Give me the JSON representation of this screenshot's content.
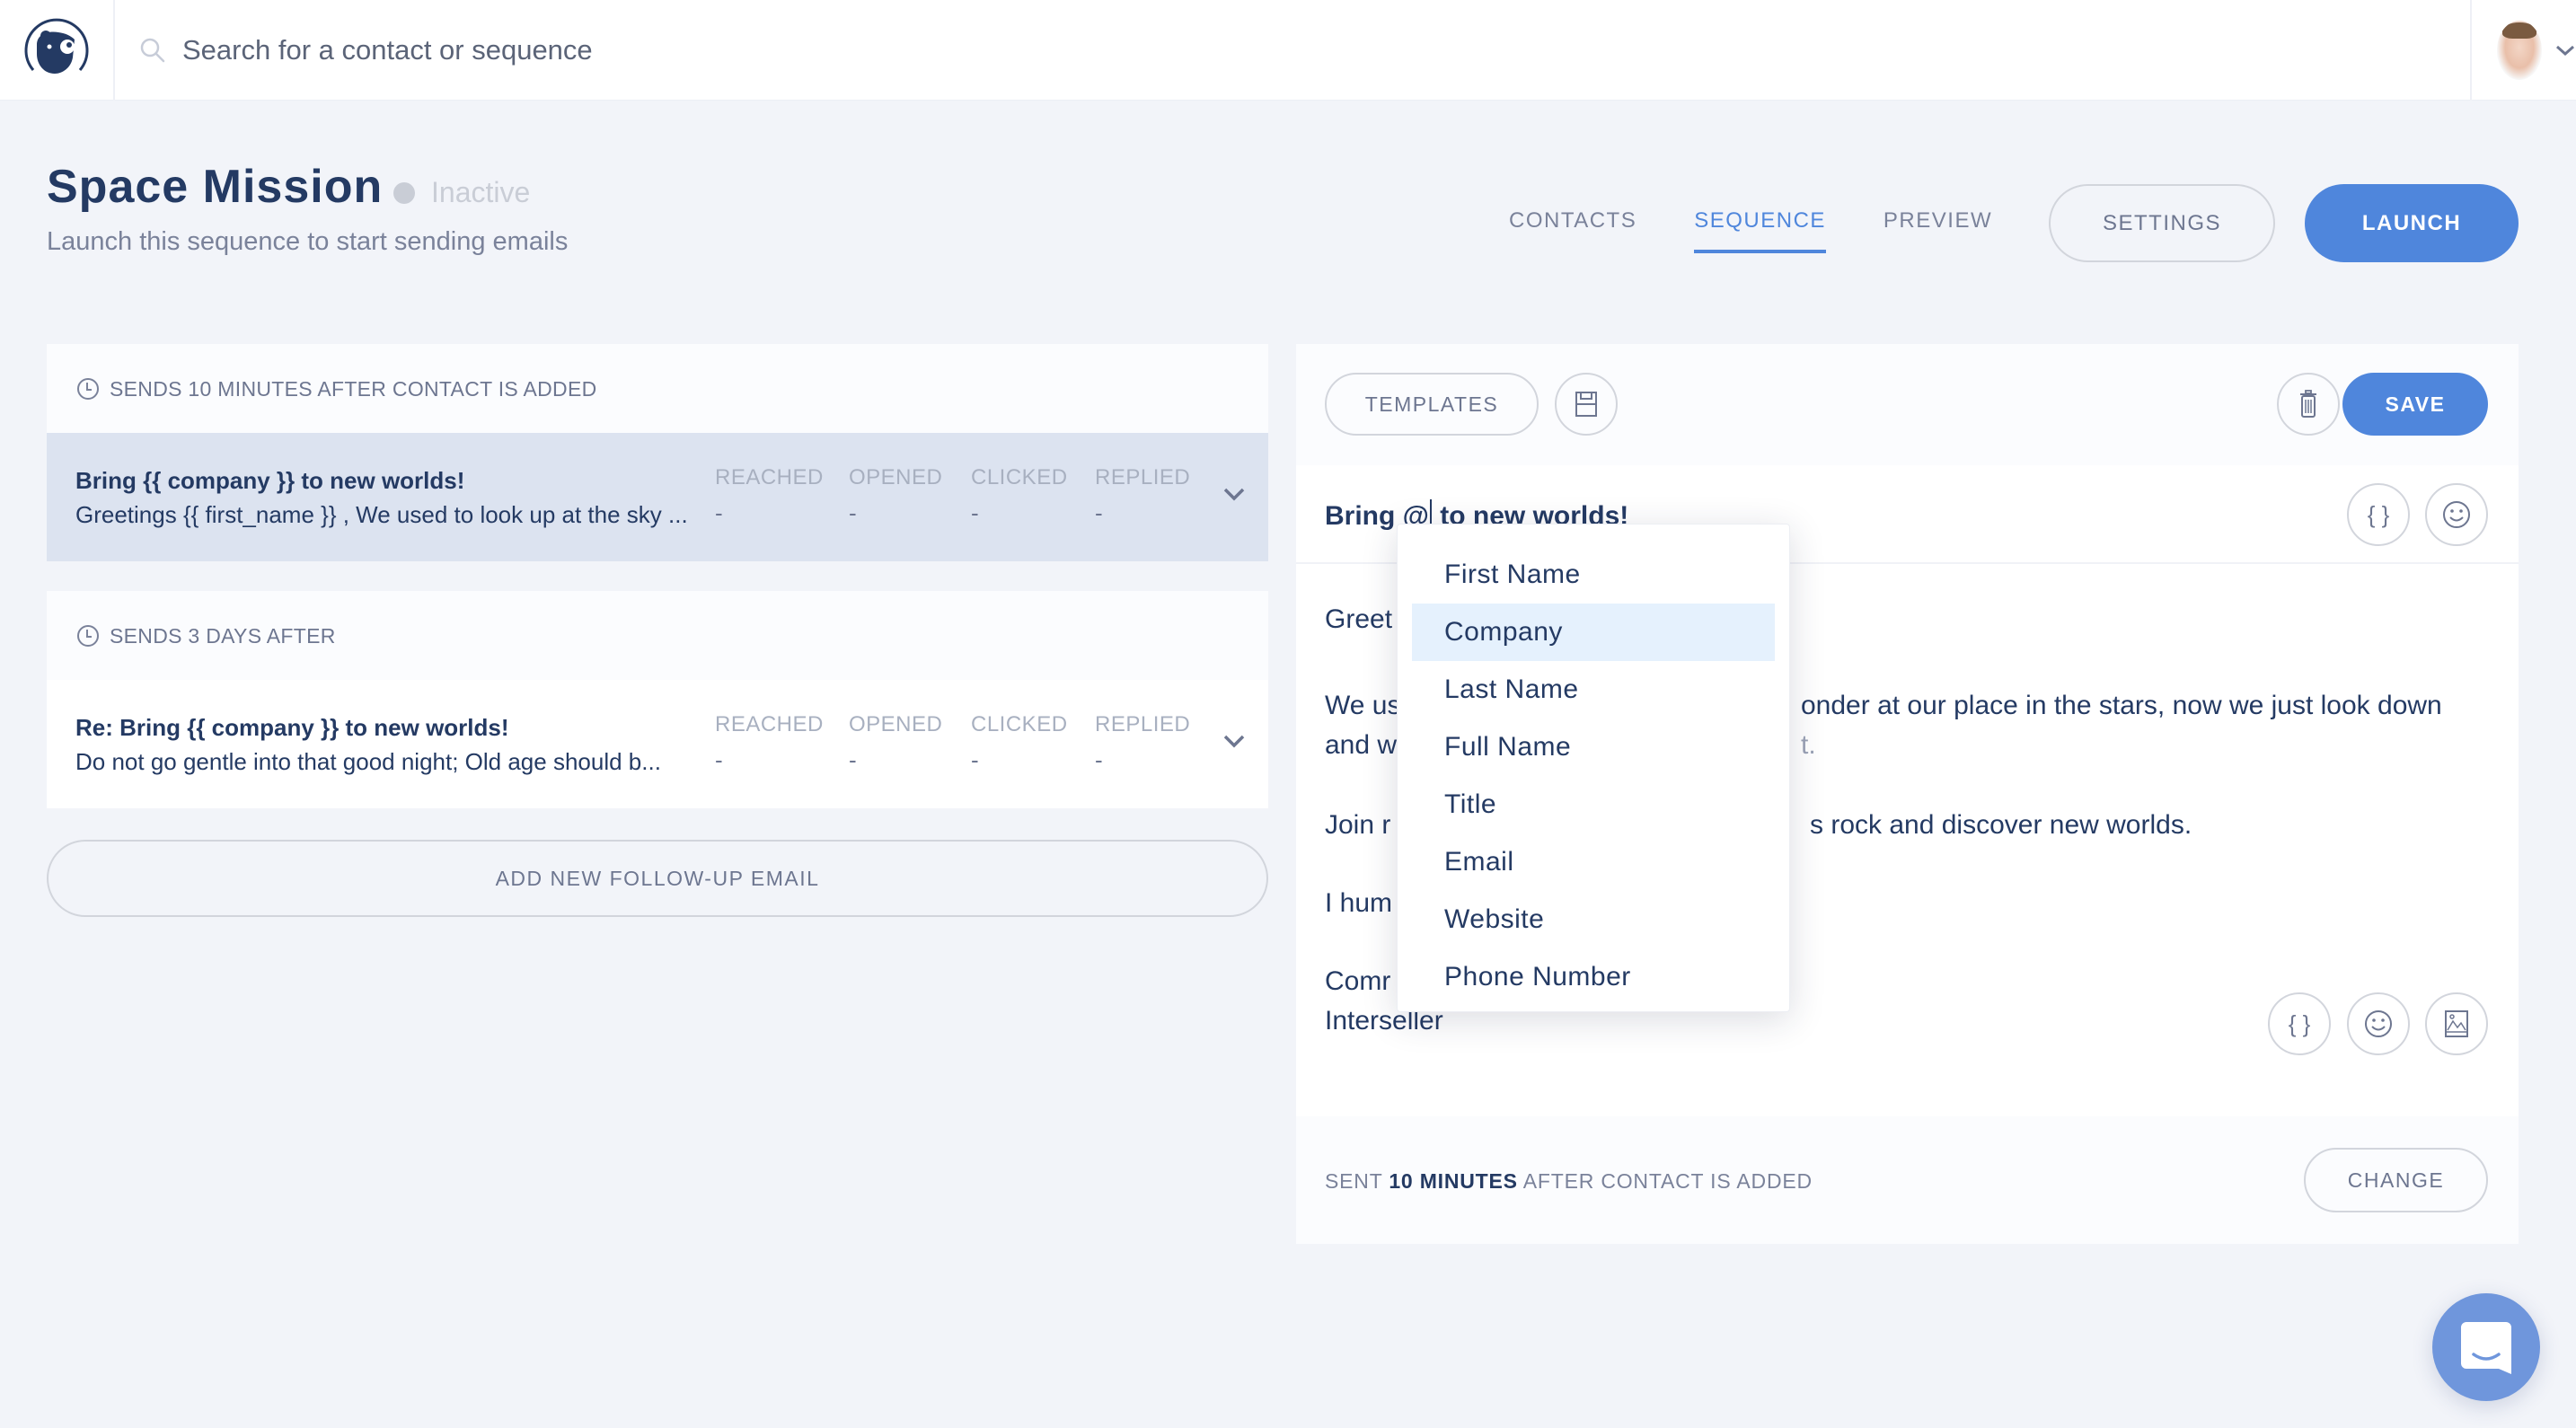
{
  "topbar": {
    "logo_alt": "bear-logo",
    "search_placeholder": "Search for a contact or sequence",
    "user_menu": "account-menu"
  },
  "page": {
    "title": "Space Mission",
    "status": "Inactive",
    "subtitle": "Launch this sequence to start sending emails"
  },
  "tabs": [
    {
      "label": "CONTACTS",
      "active": false
    },
    {
      "label": "SEQUENCE",
      "active": true
    },
    {
      "label": "PREVIEW",
      "active": false
    }
  ],
  "actions": {
    "settings_label": "SETTINGS",
    "launch_label": "LAUNCH"
  },
  "colors": {
    "accent": "#4f86dc",
    "text_dark": "#243a63",
    "muted": "#7a829a",
    "page_bg": "#f2f4f9",
    "selected_row": "#dce3f0",
    "dropdown_highlight": "#e5f1fd"
  },
  "steps": [
    {
      "schedule": "SENDS 10 MINUTES AFTER CONTACT IS ADDED",
      "subject": "Bring {{ company }} to new worlds!",
      "preview": "Greetings {{ first_name }} , We used to look up at the sky ...",
      "selected": true,
      "stats": [
        {
          "label": "REACHED",
          "value": "-"
        },
        {
          "label": "OPENED",
          "value": "-"
        },
        {
          "label": "CLICKED",
          "value": "-"
        },
        {
          "label": "REPLIED",
          "value": "-"
        }
      ]
    },
    {
      "schedule": "SENDS 3 DAYS AFTER",
      "subject": "Re: Bring {{ company }} to new worlds!",
      "preview": "Do not go gentle into that good night; Old age should b...",
      "selected": false,
      "stats": [
        {
          "label": "REACHED",
          "value": "-"
        },
        {
          "label": "OPENED",
          "value": "-"
        },
        {
          "label": "CLICKED",
          "value": "-"
        },
        {
          "label": "REPLIED",
          "value": "-"
        }
      ]
    }
  ],
  "add_followup_label": "ADD NEW FOLLOW-UP EMAIL",
  "editor": {
    "templates_label": "TEMPLATES",
    "save_label": "SAVE",
    "subject_before": "Bring @",
    "subject_after": " to new worlds!",
    "body_lines": [
      {
        "left": "Greet",
        "right": ""
      },
      {
        "left": "We us",
        "right": "onder at our place in the stars, now we just look down"
      },
      {
        "left": "and w",
        "right": "t."
      },
      {
        "left": "Join r",
        "right": "s rock and discover new worlds."
      },
      {
        "left": "I hum",
        "right": ""
      },
      {
        "left": "Comr",
        "right": ""
      },
      {
        "left": "Interseller",
        "right": ""
      }
    ],
    "footer_prefix": "SENT ",
    "footer_bold": "10 MINUTES",
    "footer_suffix": " AFTER CONTACT IS ADDED",
    "change_label": "CHANGE"
  },
  "merge_dropdown": {
    "items": [
      "First Name",
      "Company",
      "Last Name",
      "Full Name",
      "Title",
      "Email",
      "Website",
      "Phone Number"
    ],
    "highlighted": "Company"
  }
}
